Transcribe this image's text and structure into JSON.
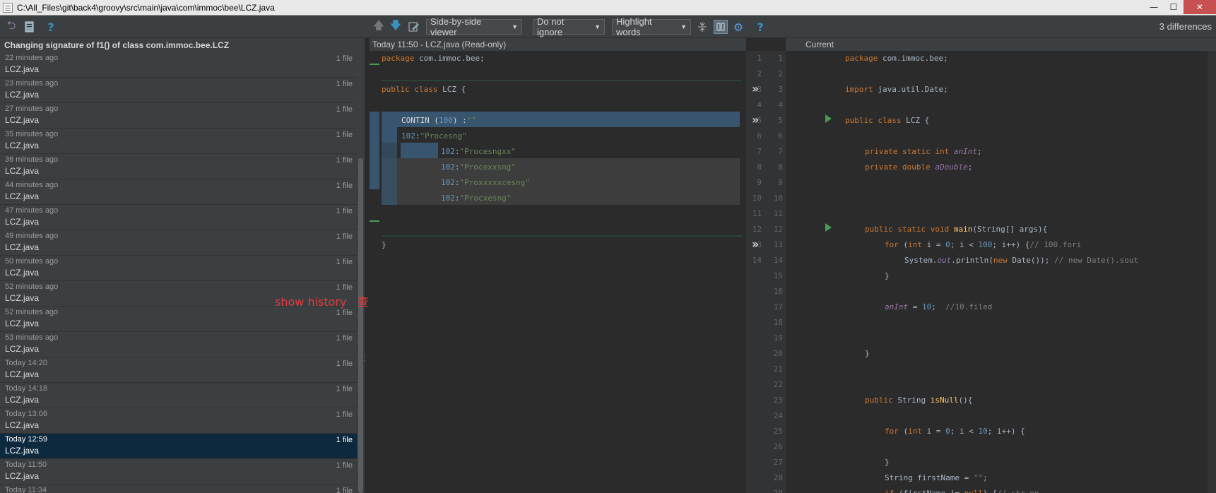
{
  "window": {
    "title": "C:\\All_Files\\git\\back4\\groovy\\src\\main\\java\\com\\immoc\\bee\\LCZ.java",
    "minimize": "—",
    "maximize": "☐",
    "close": "✕"
  },
  "toolbar": {
    "viewer": "Side-by-side viewer",
    "ignore": "Do not ignore",
    "highlight": "Highlight words",
    "diff_count": "3 differences",
    "help": "?"
  },
  "history": {
    "heading": "Changing signature of f1() of class com.immoc.bee.LCZ",
    "rows": [
      {
        "time": "22 minutes ago",
        "file": "LCZ.java",
        "count": "1 file"
      },
      {
        "time": "23 minutes ago",
        "file": "LCZ.java",
        "count": "1 file"
      },
      {
        "time": "27 minutes ago",
        "file": "LCZ.java",
        "count": "1 file"
      },
      {
        "time": "35 minutes ago",
        "file": "LCZ.java",
        "count": "1 file"
      },
      {
        "time": "36 minutes ago",
        "file": "LCZ.java",
        "count": "1 file"
      },
      {
        "time": "44 minutes ago",
        "file": "LCZ.java",
        "count": "1 file"
      },
      {
        "time": "47 minutes ago",
        "file": "LCZ.java",
        "count": "1 file"
      },
      {
        "time": "49 minutes ago",
        "file": "LCZ.java",
        "count": "1 file"
      },
      {
        "time": "50 minutes ago",
        "file": "LCZ.java",
        "count": "1 file"
      },
      {
        "time": "52 minutes ago",
        "file": "LCZ.java",
        "count": "1 file"
      },
      {
        "time": "52 minutes ago",
        "file": "LCZ.java",
        "count": "1 file"
      },
      {
        "time": "53 minutes ago",
        "file": "LCZ.java",
        "count": "1 file"
      },
      {
        "time": "Today 14:20",
        "file": "LCZ.java",
        "count": "1 file"
      },
      {
        "time": "Today 14:18",
        "file": "LCZ.java",
        "count": "1 file"
      },
      {
        "time": "Today 13:06",
        "file": "LCZ.java",
        "count": "1 file"
      },
      {
        "time": "Today 12:59",
        "file": "LCZ.java",
        "count": "1 file",
        "selected": true
      },
      {
        "time": "Today 11:50",
        "file": "LCZ.java",
        "count": "1 file"
      },
      {
        "time": "Today 11:34",
        "file": "",
        "count": "1 file"
      }
    ]
  },
  "annotation": "show history   查询代码的修改过程",
  "left_pane": {
    "header": "Today 11:50 - LCZ.java (Read-only)"
  },
  "right_pane": {
    "header": "Current"
  },
  "left_gutter_numbers": [
    "1",
    "2",
    "3",
    "4",
    "5",
    "6",
    "7",
    "8",
    "9",
    "10",
    "11",
    "12",
    "13",
    "14"
  ],
  "right_gutter_numbers": [
    "1",
    "2",
    "3",
    "4",
    "5",
    "6",
    "7",
    "8",
    "9",
    "10",
    "11",
    "12",
    "13",
    "14",
    "15",
    "16",
    "17",
    "18",
    "19",
    "20",
    "21",
    "22",
    "23",
    "24",
    "25",
    "26",
    "27",
    "28",
    "29"
  ],
  "colors": {
    "inserted": "#294436",
    "modified": "#385570",
    "selected_row": "#0d293e",
    "annotation": "#e3393b"
  }
}
